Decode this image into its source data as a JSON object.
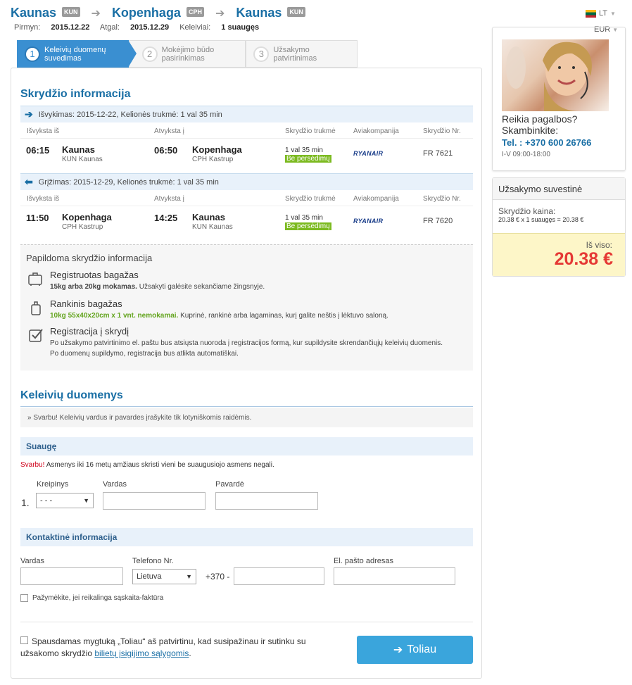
{
  "header": {
    "route": [
      {
        "city": "Kaunas",
        "code": "KUN"
      },
      {
        "city": "Kopenhaga",
        "code": "CPH"
      },
      {
        "city": "Kaunas",
        "code": "KUN"
      }
    ],
    "there_label": "Pirmyn:",
    "there_date": "2015.12.22",
    "back_label": "Atgal:",
    "back_date": "2015.12.29",
    "pax_label": "Keleiviai:",
    "pax_value": "1 suaugęs",
    "language": "LT",
    "currency": "EUR"
  },
  "steps": [
    {
      "num": "1",
      "label1": "Keleivių duomenų",
      "label2": "suvedimas"
    },
    {
      "num": "2",
      "label1": "Mokėjimo būdo",
      "label2": "pasirinkimas"
    },
    {
      "num": "3",
      "label1": "Užsakymo",
      "label2": "patvirtinimas"
    }
  ],
  "flight_info": {
    "title": "Skrydžio informacija",
    "columns": [
      "Išvyksta iš",
      "Atvyksta į",
      "Skrydžio trukmė",
      "Aviakompanija",
      "Skrydžio Nr."
    ],
    "legs": [
      {
        "head": "Išvykimas: 2015-12-22, Kelionės trukmė: 1 val 35 min",
        "dep_time": "06:15",
        "dep_city": "Kaunas",
        "dep_airport": "KUN Kaunas",
        "arr_time": "06:50",
        "arr_city": "Kopenhaga",
        "arr_airport": "CPH Kastrup",
        "duration": "1 val 35 min",
        "stops": "Be persėdimų",
        "airline": "RYANAIR",
        "flight_no": "FR 7621"
      },
      {
        "head": "Grįžimas: 2015-12-29, Kelionės trukmė: 1 val 35 min",
        "dep_time": "11:50",
        "dep_city": "Kopenhaga",
        "dep_airport": "CPH Kastrup",
        "arr_time": "14:25",
        "arr_city": "Kaunas",
        "arr_airport": "KUN Kaunas",
        "duration": "1 val 35 min",
        "stops": "Be persėdimų",
        "airline": "RYANAIR",
        "flight_no": "FR 7620"
      }
    ],
    "extra": {
      "title": "Papildoma skrydžio informacija",
      "items": [
        {
          "title": "Registruotas bagažas",
          "bold": "15kg arba 20kg mokamas.",
          "text": " Užsakyti galėsite sekančiame žingsnyje."
        },
        {
          "title": "Rankinis bagažas",
          "bold": "10kg 55x40x20cm x 1 vnt. nemokamai.",
          "text": " Kuprinė, rankinė arba lagaminas, kurį galite neštis į lėktuvo saloną."
        },
        {
          "title": "Registracija į skrydį",
          "line1": "Po užsakymo patvirtinimo el. paštu bus atsiųsta nuoroda į registracijos formą, kur supildysite skrendančiųjų keleivių duomenis.",
          "line2": "Po duomenų supildymo, registracija bus atlikta automatiškai."
        }
      ]
    }
  },
  "passengers": {
    "title": "Keleivių duomenys",
    "note": "» Svarbu! Keleivių vardus ir pavardes įrašykite tik lotyniškomis raidėmis.",
    "band": "Suaugę",
    "warn_red": "Svarbu!",
    "warn_text": " Asmenys iki 16 metų amžiaus skristi vieni be suaugusiojo asmens negali.",
    "row_num": "1.",
    "labels": {
      "title": "Kreipinys",
      "first": "Vardas",
      "last": "Pavardė"
    },
    "title_value": "- - -"
  },
  "contact": {
    "band": "Kontaktinė informacija",
    "labels": {
      "name": "Vardas",
      "phone": "Telefono Nr.",
      "email": "El. pašto adresas"
    },
    "country": "Lietuva",
    "prefix": "+370 -",
    "invoice_label": "Pažymėkite, jei reikalinga sąskaita-faktūra"
  },
  "confirm": {
    "text1": "Spausdamas mygtuką „Toliau“ aš patvirtinu, kad susipažinau ir sutinku su",
    "text2": "užsakomo skrydžio ",
    "link": "bilietų įsigijimo sąlygomis",
    "tail": ".",
    "button": "Toliau"
  },
  "help": {
    "line1": "Reikia pagalbos?",
    "line2": "Skambinkite:",
    "phone": "Tel. : +370 600 26766",
    "hours": "I-V 09:00-18:00"
  },
  "summary": {
    "title": "Užsakymo suvestinė",
    "price_label": "Skrydžio kaina:",
    "price_calc": "20.38 € x 1 suaugęs = 20.38 €",
    "total_label": "Iš viso:",
    "total": "20.38 €"
  },
  "colors": {
    "accent": "#1a6fa5",
    "step_active": "#3a8fd1",
    "button": "#3aa5dc",
    "total": "#e53935",
    "green": "#7cba20"
  }
}
